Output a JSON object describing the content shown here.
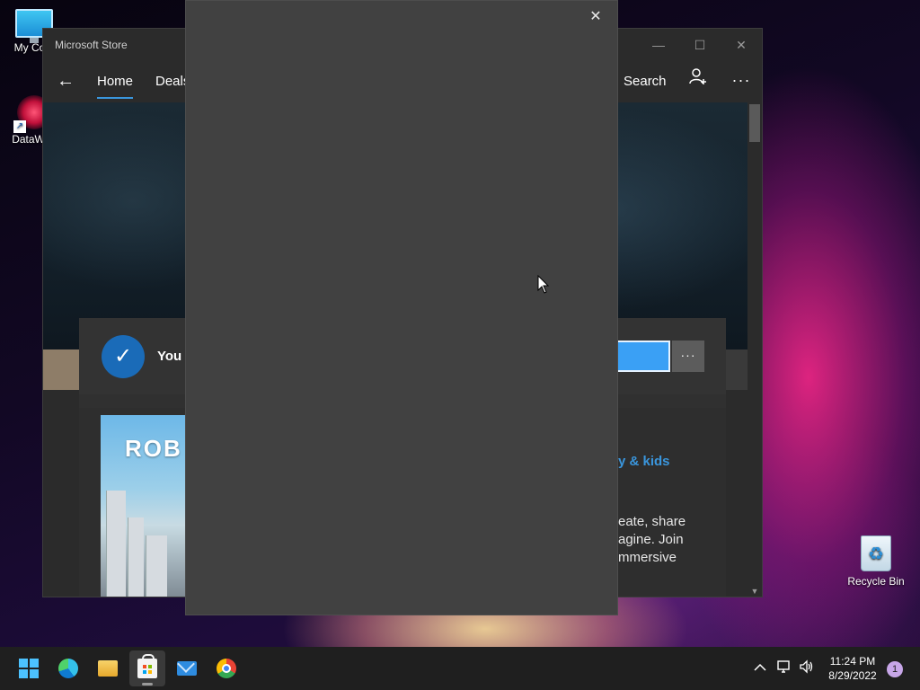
{
  "desktop": {
    "icons": [
      {
        "label": "My Com",
        "icon": "computer-icon"
      },
      {
        "label": "DataWag",
        "icon": "datawag-icon"
      },
      {
        "label": "Recycle Bin",
        "icon": "recycle-bin-icon"
      }
    ]
  },
  "store": {
    "window_title": "Microsoft Store",
    "window_controls": {
      "minimize": "—",
      "maximize": "☐",
      "close": "✕"
    },
    "nav": {
      "back_icon": "←",
      "tabs": [
        "Home",
        "Deals"
      ],
      "search_label": "Search",
      "account_icon": "person-add-icon",
      "more_icon": "···"
    },
    "notice": {
      "text": "You c",
      "more_label": "···"
    },
    "app": {
      "tile_text": "ROB",
      "category_link": "y & kids",
      "description_lines": [
        "eate, share",
        "agine. Join",
        "mmersive"
      ]
    }
  },
  "dialog": {
    "close_icon": "✕"
  },
  "taskbar": {
    "apps": [
      "start-icon",
      "edge-icon",
      "file-explorer-icon",
      "microsoft-store-icon",
      "mail-icon",
      "chrome-icon"
    ],
    "active_app": "microsoft-store-icon",
    "tray": {
      "chevron": "^",
      "network_icon": "network-icon",
      "volume_icon": "volume-icon"
    },
    "time": "11:24 PM",
    "date": "8/29/2022",
    "notification_count": "1"
  }
}
